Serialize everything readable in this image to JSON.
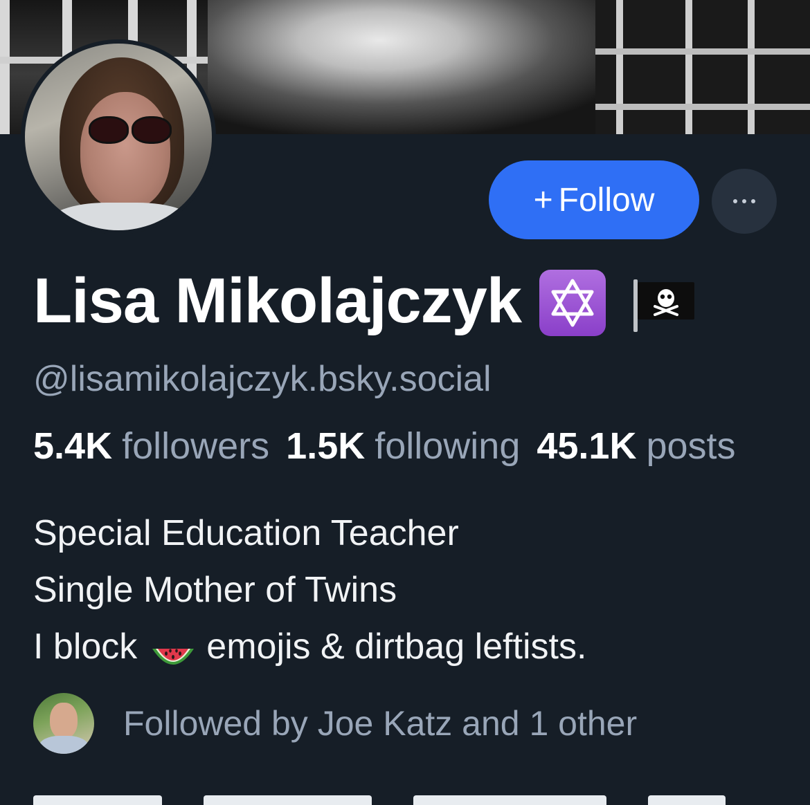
{
  "profile": {
    "display_name": "Lisa Mikolajczyk",
    "handle": "@lisamikolajczyk.bsky.social",
    "badges": [
      "star-of-david-emoji",
      "pirate-flag-emoji"
    ]
  },
  "actions": {
    "follow_label": "Follow",
    "follow_plus": "+",
    "more_icon": "ellipsis-icon"
  },
  "stats": {
    "followers_count": "5.4K",
    "followers_label": "followers",
    "following_count": "1.5K",
    "following_label": "following",
    "posts_count": "45.1K",
    "posts_label": "posts"
  },
  "bio": {
    "line1": "Special Education Teacher",
    "line2": "Single Mother of Twins",
    "line3_prefix": "I block",
    "line3_emoji": "watermelon-emoji",
    "line3_suffix": "emojis & dirtbag leftists."
  },
  "followed_by": {
    "text": "Followed by Joe Katz and 1 other"
  },
  "colors": {
    "background": "#161e27",
    "accent": "#2f6ff5",
    "muted_text": "#99a6b8",
    "secondary_button": "#27313e"
  }
}
